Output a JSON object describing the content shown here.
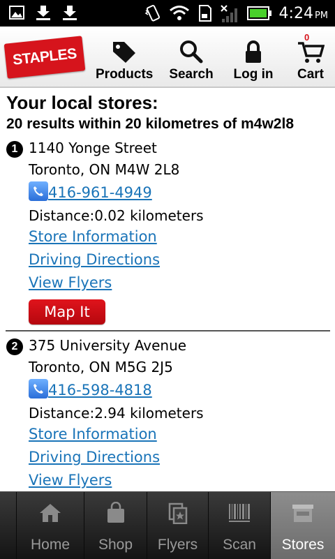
{
  "status_bar": {
    "time": "4:24",
    "ampm": "PM",
    "icons": [
      "gallery-icon",
      "download-icon",
      "download-icon",
      "vibrate-icon",
      "wifi-icon",
      "sd-card-icon",
      "signal-icon",
      "battery-icon"
    ]
  },
  "header": {
    "logo_text": "STAPLES",
    "nav": [
      {
        "label": "Products",
        "icon": "tag-icon"
      },
      {
        "label": "Search",
        "icon": "magnifier-icon"
      },
      {
        "label": "Log in",
        "icon": "lock-icon"
      },
      {
        "label": "Cart",
        "icon": "cart-icon"
      }
    ],
    "cart_count": "0",
    "brand_color": "#d6141c"
  },
  "main": {
    "title": "Your local stores:",
    "subtitle": "20 results within 20 kilometres of m4w2l8",
    "stores": [
      {
        "number": "1",
        "address": "1140 Yonge Street",
        "city": "Toronto, ON M4W 2L8",
        "phone": "416-961-4949",
        "distance": "Distance:0.02 kilometers",
        "store_info": "Store Information",
        "directions": "Driving Directions",
        "flyers": "View Flyers",
        "map_button": "Map It"
      },
      {
        "number": "2",
        "address": "375 University Avenue",
        "city": "Toronto, ON M5G 2J5",
        "phone": "416-598-4818",
        "distance": "Distance:2.94 kilometers",
        "store_info": "Store Information",
        "directions": "Driving Directions",
        "flyers": "View Flyers"
      }
    ],
    "link_color": "#1a74b8"
  },
  "tabbar": {
    "tabs": [
      {
        "label": "Home",
        "icon": "home-icon"
      },
      {
        "label": "Shop",
        "icon": "shopping-bag-icon"
      },
      {
        "label": "Flyers",
        "icon": "flyers-icon"
      },
      {
        "label": "Scan",
        "icon": "barcode-icon"
      },
      {
        "label": "Stores",
        "icon": "store-icon",
        "active": true
      }
    ]
  }
}
